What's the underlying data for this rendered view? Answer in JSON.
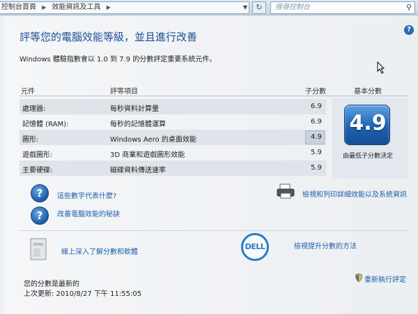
{
  "address_bar": {
    "breadcrumb": [
      "控制台首頁",
      "效能資訊及工具"
    ],
    "search_placeholder": "搜尋控制台"
  },
  "page": {
    "title": "評等您的電腦效能等級，並且進行改善",
    "subtitle": "Windows 體驗指數會以 1.0 到 7.9 的分數評定重要系統元件。"
  },
  "table": {
    "headers": [
      "元件",
      "評等項目",
      "子分數",
      "基本分數"
    ],
    "rows": [
      {
        "component": "處理器:",
        "rating": "每秒資料計算量",
        "subscore": "6.9"
      },
      {
        "component": "記憶體 (RAM):",
        "rating": "每秒的記憶體運算",
        "subscore": "6.9"
      },
      {
        "component": "圖形:",
        "rating": "Windows Aero 的桌面效能",
        "subscore": "4.9"
      },
      {
        "component": "遊戲圖形:",
        "rating": "3D 商業和遊戲圖形效能",
        "subscore": "5.9"
      },
      {
        "component": "主要硬碟:",
        "rating": "磁碟資料傳送速率",
        "subscore": "5.9"
      }
    ],
    "base_score": "4.9",
    "base_score_note": "由最低子分數決定"
  },
  "links": {
    "what_numbers_mean": "這些數字代表什麼?",
    "improve_tips": "改善電腦效能的秘訣",
    "print_details": "檢視和列印詳細效能以及系統資訊",
    "learn_online": "線上深入了解分數和軟體",
    "view_ways": "檢視提升分數的方法",
    "rerun": "重新執行評定"
  },
  "brand": "DELL",
  "status": {
    "line1": "您的分數是最新的",
    "line2": "上次更新: 2010/8/27 下午 11:55:05"
  },
  "colors": {
    "title": "#1d4f94",
    "link": "#1f5fa8",
    "badge": "#1d5fae"
  },
  "icons": [
    "help-icon",
    "question-icon",
    "printer-icon",
    "software-box-icon",
    "dell-logo",
    "shield-icon",
    "refresh-icon",
    "search-icon"
  ]
}
